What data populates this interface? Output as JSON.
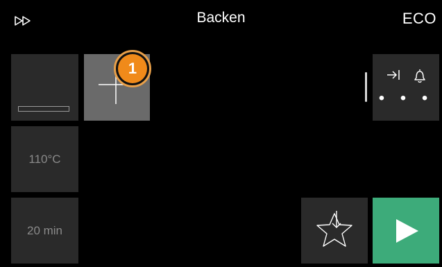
{
  "header": {
    "title": "Backen",
    "mode_label": "ECO"
  },
  "tiles": {
    "temperature": "110°C",
    "duration": "20 min"
  },
  "badge": {
    "count": "1"
  },
  "options": {
    "dots": "• • •"
  },
  "colors": {
    "background": "#000000",
    "tile": "#2a2a2a",
    "active_tile": "#6a6a6a",
    "badge": "#f08a1a",
    "start_button": "#3dab7a"
  },
  "icons": [
    "fast-forward-icon",
    "tray-icon",
    "plus-icon",
    "skip-to-end-icon",
    "bell-icon",
    "more-dots-icon",
    "star-download-icon",
    "play-icon"
  ]
}
